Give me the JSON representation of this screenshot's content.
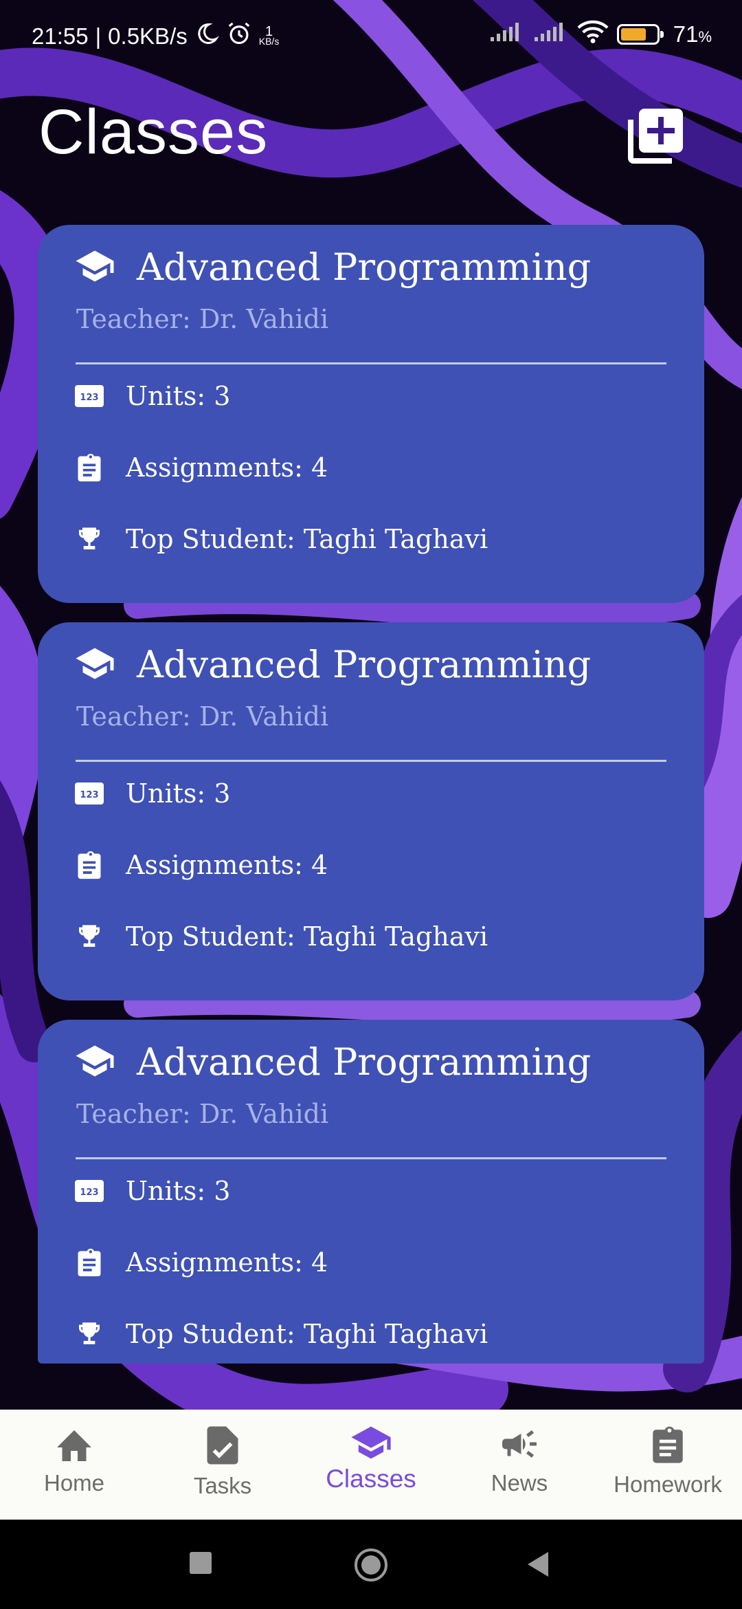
{
  "status_bar": {
    "time": "21:55",
    "speed": "0.5KB/s",
    "net_count": "1",
    "net_unit": "KB/s",
    "battery_percent": "71",
    "battery_symbol": "%",
    "battery_level": 0.71,
    "icons": [
      "moon-icon",
      "alarm-icon",
      "signal-icon",
      "signal-icon",
      "wifi-icon",
      "battery-icon"
    ]
  },
  "header": {
    "title": "Classes",
    "add_icon": "add-library-icon"
  },
  "cards": [
    {
      "title": "Advanced Programming",
      "teacher": "Teacher: Dr. Vahidi",
      "units": "Units: 3",
      "assignments": "Assignments: 4",
      "top_student": "Top Student: Taghi Taghavi",
      "icons": [
        "school-icon",
        "numbers-icon",
        "clipboard-icon",
        "trophy-icon"
      ]
    },
    {
      "title": "Advanced Programming",
      "teacher": "Teacher: Dr. Vahidi",
      "units": "Units: 3",
      "assignments": "Assignments: 4",
      "top_student": "Top Student: Taghi Taghavi",
      "icons": [
        "school-icon",
        "numbers-icon",
        "clipboard-icon",
        "trophy-icon"
      ]
    },
    {
      "title": "Advanced Programming",
      "teacher": "Teacher: Dr. Vahidi",
      "units": "Units: 3",
      "assignments": "Assignments: 4",
      "top_student": "Top Student: Taghi Taghavi",
      "icons": [
        "school-icon",
        "numbers-icon",
        "clipboard-icon",
        "trophy-icon"
      ]
    }
  ],
  "nav": {
    "items": [
      {
        "label": "Home",
        "icon": "home-icon"
      },
      {
        "label": "Tasks",
        "icon": "task-icon"
      },
      {
        "label": "Classes",
        "icon": "school-icon",
        "active": true
      },
      {
        "label": "News",
        "icon": "campaign-icon"
      },
      {
        "label": "Homework",
        "icon": "clipboard-icon"
      }
    ]
  },
  "colors": {
    "card": "#3f51b5",
    "accent": "#7a4be0",
    "nav_bg": "#fbfcf8"
  }
}
